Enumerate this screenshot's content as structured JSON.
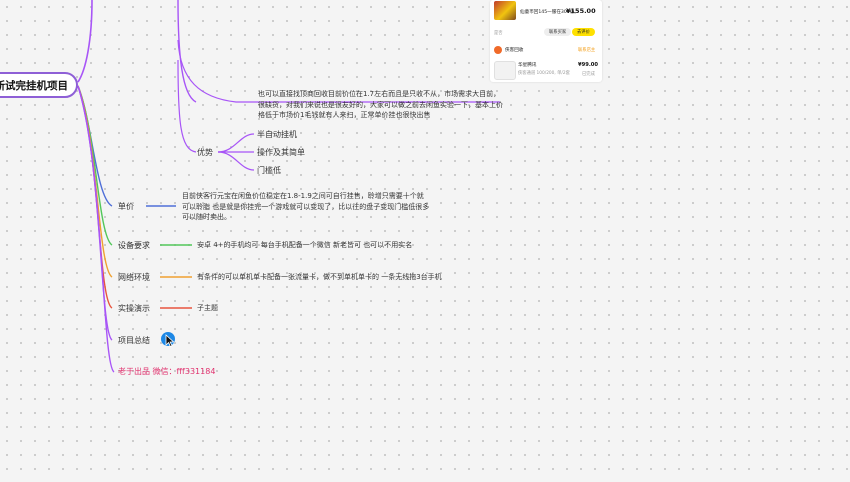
{
  "root": {
    "label": "新试完挂机项目"
  },
  "nodes": {
    "price_desc": "也可以直接找顶商回收目前价位在1.7左右而且是只收不从，市场需求大目前，很缺货，对我们来说也是很友好的，大家可以做之前去闲鱼实验一下，基本上价格低于市场价1毛钱就有人来扫，正常单价挂也很快出售",
    "advantages": {
      "label": "优势",
      "items": [
        "半自动挂机",
        "操作及其简单",
        "门槛低"
      ]
    },
    "unit_price": {
      "label": "单价",
      "desc": "目前侠客行元宝在闲鱼价位稳定在1.8-1.9之间可自行挂售，聆增只需要十个就可以聆脂 也是就是你挂完一个游戏就可以变现了，比以往的盘子变现门槛低很多可以随时卖出。"
    },
    "device": {
      "label": "设备要求",
      "desc": "安卓 4+的手机均可 每台手机配备一个微信 新老皆可 也可以不用实名"
    },
    "network": {
      "label": "网络环境",
      "desc": "有条件的可以单机单卡配备一张流量卡，做不到单机单卡的 一条无线拖3台手机"
    },
    "demo": {
      "label": "实操演示",
      "desc": "子主题"
    },
    "summary": {
      "label": "项目总结"
    },
    "contact": {
      "label": "老于出品  微信：fff331184"
    }
  },
  "embed": {
    "item_title": "仙童币回145一服在300级。",
    "price": "¥155.00",
    "left_label": "是否",
    "btn1": "联系买家",
    "btn2": "去评价",
    "shop": "侠客回收",
    "shop_action": "联系店主",
    "item2_title": "华星腾讯",
    "item2_sub": "侠客通道  100/200,  单/2套",
    "item2_price": "¥99.00",
    "item2_status": "已完成"
  },
  "colors": {
    "purple": "#a855f7",
    "blue": "#4f6fd8",
    "green": "#52c75a",
    "orange": "#f0a030",
    "red": "#e8553e",
    "pink": "#e0326e"
  }
}
